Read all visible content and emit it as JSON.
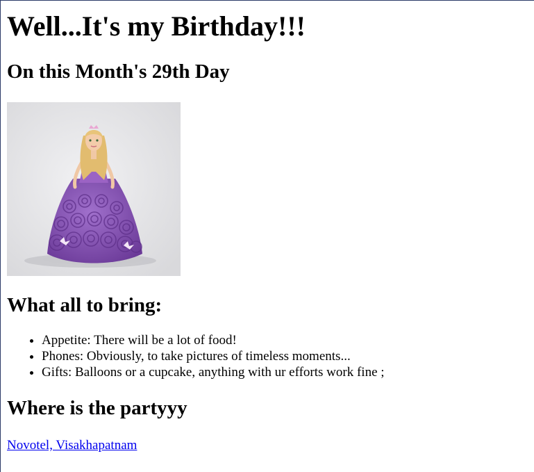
{
  "heading": "Well...It's my Birthday!!!",
  "subheading": "On this Month's 29th Day",
  "image": {
    "icon": "princess-doll-cake-icon",
    "colors": {
      "background": "#e6e6e8",
      "dress": "#8a55b8",
      "dress_dark": "#6e3d9d",
      "hair": "#e5c27a",
      "skin": "#f0c8a5"
    }
  },
  "bring": {
    "title": "What all to bring:",
    "items": [
      "Appetite: There will be a lot of food!",
      "Phones: Obviously, to take pictures of timeless moments...",
      "Gifts: Balloons or a cupcake, anything with ur efforts work fine ;"
    ]
  },
  "party": {
    "title": "Where is the partyyy",
    "link_text": "Novotel, Visakhapatnam"
  },
  "colors": {
    "link": "#0000ee",
    "frame_border": "#2b3a67"
  }
}
